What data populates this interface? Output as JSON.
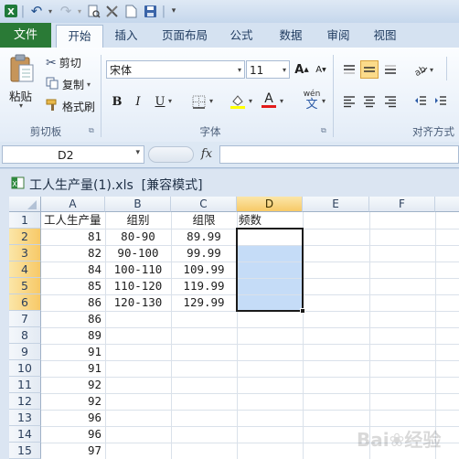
{
  "quick_access": {
    "undo": "↶",
    "redo": "↷"
  },
  "tabs": [
    {
      "label": "文件"
    },
    {
      "label": "开始"
    },
    {
      "label": "插入"
    },
    {
      "label": "页面布局"
    },
    {
      "label": "公式"
    },
    {
      "label": "数据"
    },
    {
      "label": "审阅"
    },
    {
      "label": "视图"
    }
  ],
  "ribbon": {
    "paste_label": "粘贴",
    "cut_label": "剪切",
    "copy_label": "复制",
    "format_painter_label": "格式刷",
    "clipboard_group": "剪切板",
    "font_name": "宋体",
    "font_size": "11",
    "bold": "B",
    "italic": "I",
    "underline": "U",
    "font_group": "字体",
    "align_group": "对齐方式",
    "pinyin_label": "wén",
    "font_color_letter": "A",
    "grow_font": "A",
    "shrink_font": "A"
  },
  "formula_bar": {
    "name_box": "D2",
    "fx": "fx",
    "formula": ""
  },
  "workbook": {
    "title": "工人生产量(1).xls  [兼容模式]"
  },
  "sheet": {
    "columns": [
      "A",
      "B",
      "C",
      "D",
      "E",
      "F"
    ],
    "rows": [
      "1",
      "2",
      "3",
      "4",
      "5",
      "6",
      "7",
      "8",
      "9",
      "10",
      "11",
      "12",
      "13",
      "14",
      "15"
    ],
    "cells": {
      "A": [
        "工人生产量",
        "81",
        "82",
        "84",
        "85",
        "86",
        "86",
        "89",
        "91",
        "91",
        "92",
        "92",
        "96",
        "96",
        "97"
      ],
      "B": [
        "组别",
        "80-90",
        "90-100",
        "100-110",
        "110-120",
        "120-130",
        "",
        "",
        "",
        "",
        "",
        "",
        "",
        "",
        ""
      ],
      "C": [
        "组限",
        "89.99",
        "99.99",
        "109.99",
        "119.99",
        "129.99",
        "",
        "",
        "",
        "",
        "",
        "",
        "",
        "",
        ""
      ],
      "D": [
        "频数",
        "",
        "",
        "",
        "",
        "",
        "",
        "",
        "",
        "",
        "",
        "",
        "",
        "",
        ""
      ]
    },
    "selection": "D2:D6",
    "active_cell": "D2"
  },
  "colors": {
    "file_tab": "#2a7a36",
    "selection_fill": "#c5dcf7",
    "header_highlight": "#f7c967"
  }
}
